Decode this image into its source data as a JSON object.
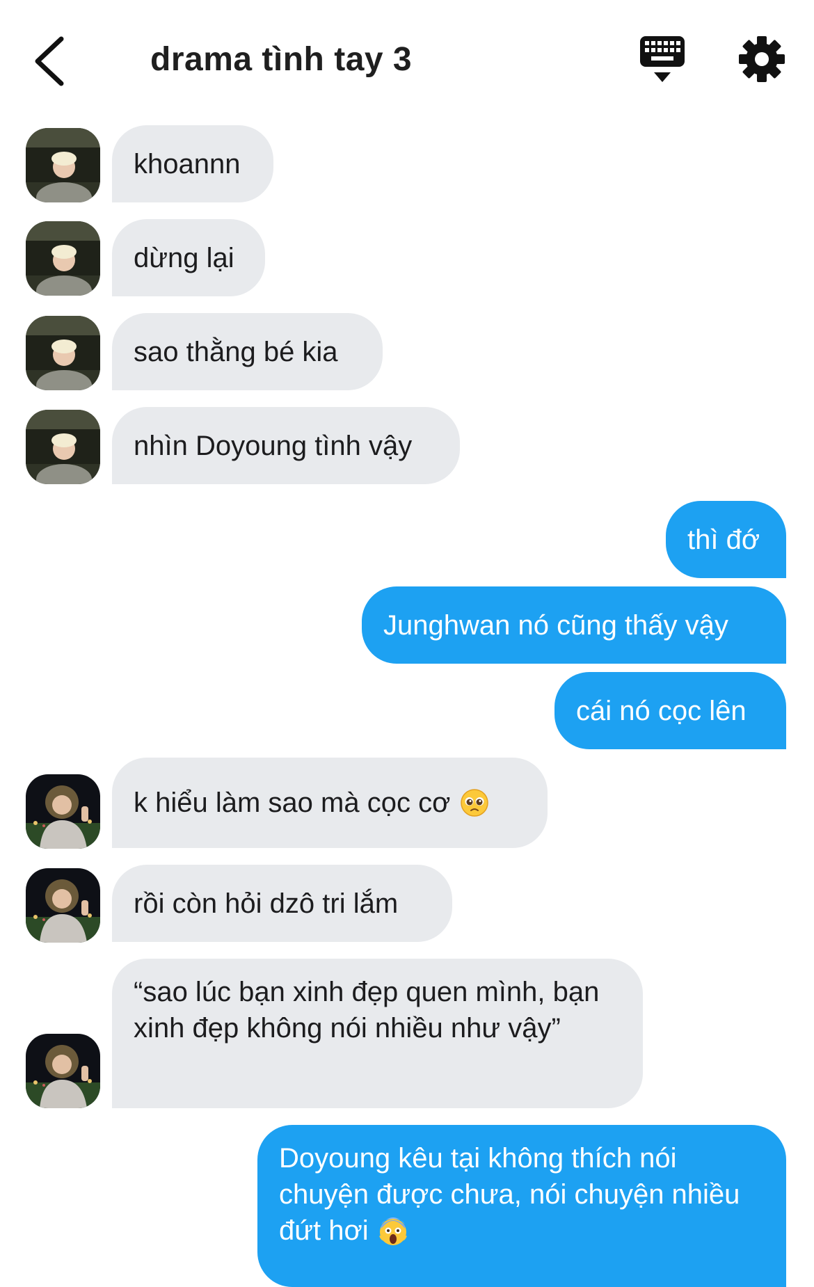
{
  "header": {
    "title": "drama tình tay 3",
    "back_icon": "chevron-left-icon",
    "keyboard_icon": "keyboard-icon",
    "settings_icon": "gear-icon"
  },
  "colors": {
    "incoming_bubble": "#e8eaed",
    "outgoing_bubble": "#1da1f2",
    "text": "#1c1c1e"
  },
  "messages": [
    {
      "sender": "other-1",
      "text": "khoannn"
    },
    {
      "sender": "other-1",
      "text": "dừng lại"
    },
    {
      "sender": "other-1",
      "text": "sao thằng bé kia"
    },
    {
      "sender": "other-1",
      "text": "nhìn Doyoung tình vậy"
    },
    {
      "sender": "me",
      "text": "thì đớ"
    },
    {
      "sender": "me",
      "text": "Junghwan nó cũng thấy vậy"
    },
    {
      "sender": "me",
      "text": "cái nó cọc lên"
    },
    {
      "sender": "other-2",
      "text": "k hiểu làm sao mà cọc cơ",
      "emoji": "pleading-face-emoji"
    },
    {
      "sender": "other-2",
      "text": "rồi còn hỏi dzô tri lắm"
    },
    {
      "sender": "other-2",
      "text": "“sao lúc bạn xinh đẹp quen mình, bạn xinh đẹp không nói nhiều như vậy”"
    },
    {
      "sender": "me",
      "text": "Doyoung kêu tại không thích nói chuyện được chưa, nói chuyện nhiều đứt hơi",
      "emoji": "screaming-face-emoji"
    }
  ]
}
